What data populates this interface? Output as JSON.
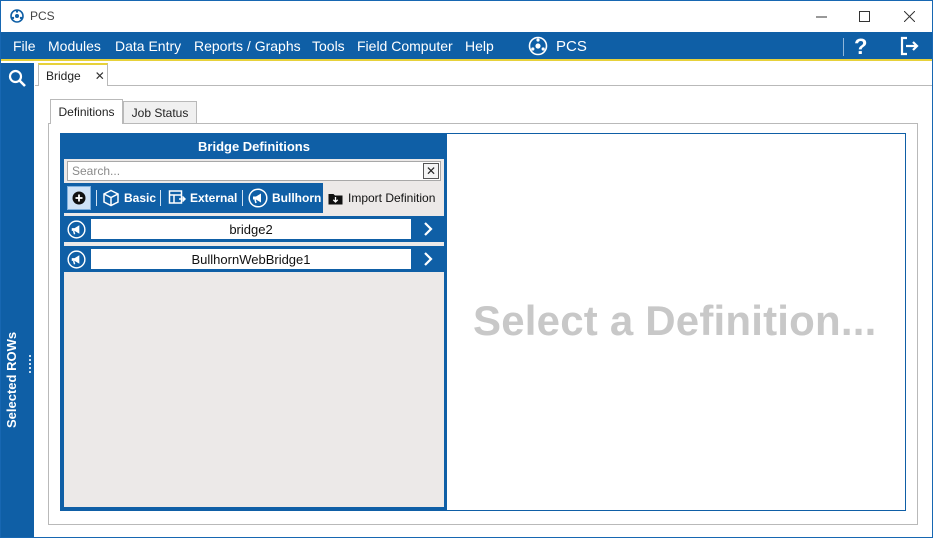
{
  "window": {
    "title": "PCS",
    "controls": {
      "minimize": "—",
      "maximize": "☐",
      "close": "✕"
    }
  },
  "menu": {
    "items": [
      "File",
      "Modules",
      "Data Entry",
      "Reports / Graphs",
      "Tools",
      "Field Computer",
      "Help"
    ],
    "brand_label": "PCS",
    "help_icon_glyph": "?"
  },
  "rail": {
    "label": "Selected ROWs"
  },
  "doc_tab": {
    "label": "Bridge",
    "close": "✕"
  },
  "sub_tabs": [
    {
      "label": "Definitions",
      "active": true
    },
    {
      "label": "Job Status",
      "active": false
    }
  ],
  "left_panel": {
    "title": "Bridge Definitions",
    "search_placeholder": "Search...",
    "search_clear": "✕",
    "toolbar": {
      "basic_label": "Basic",
      "external_label": "External",
      "bullhorn_label": "Bullhorn",
      "import_label": "Import Definition"
    },
    "definitions": [
      {
        "name": "bridge2"
      },
      {
        "name": "BullhornWebBridge1"
      }
    ]
  },
  "right_panel": {
    "placeholder": "Select a Definition..."
  },
  "colors": {
    "primary_blue": "#0f5fa6",
    "accent_yellow": "#e7d13a",
    "panel_gray": "#ece9e8",
    "placeholder_gray": "#c8c8c8"
  },
  "icons": {
    "app": "pcs-logo-icon",
    "search": "search-icon",
    "exit": "exit-icon",
    "add": "add-circle-icon",
    "basic": "cube-icon",
    "external": "external-table-icon",
    "bullhorn": "bullhorn-icon",
    "import": "folder-import-icon",
    "chevron": "chevron-right-icon"
  }
}
